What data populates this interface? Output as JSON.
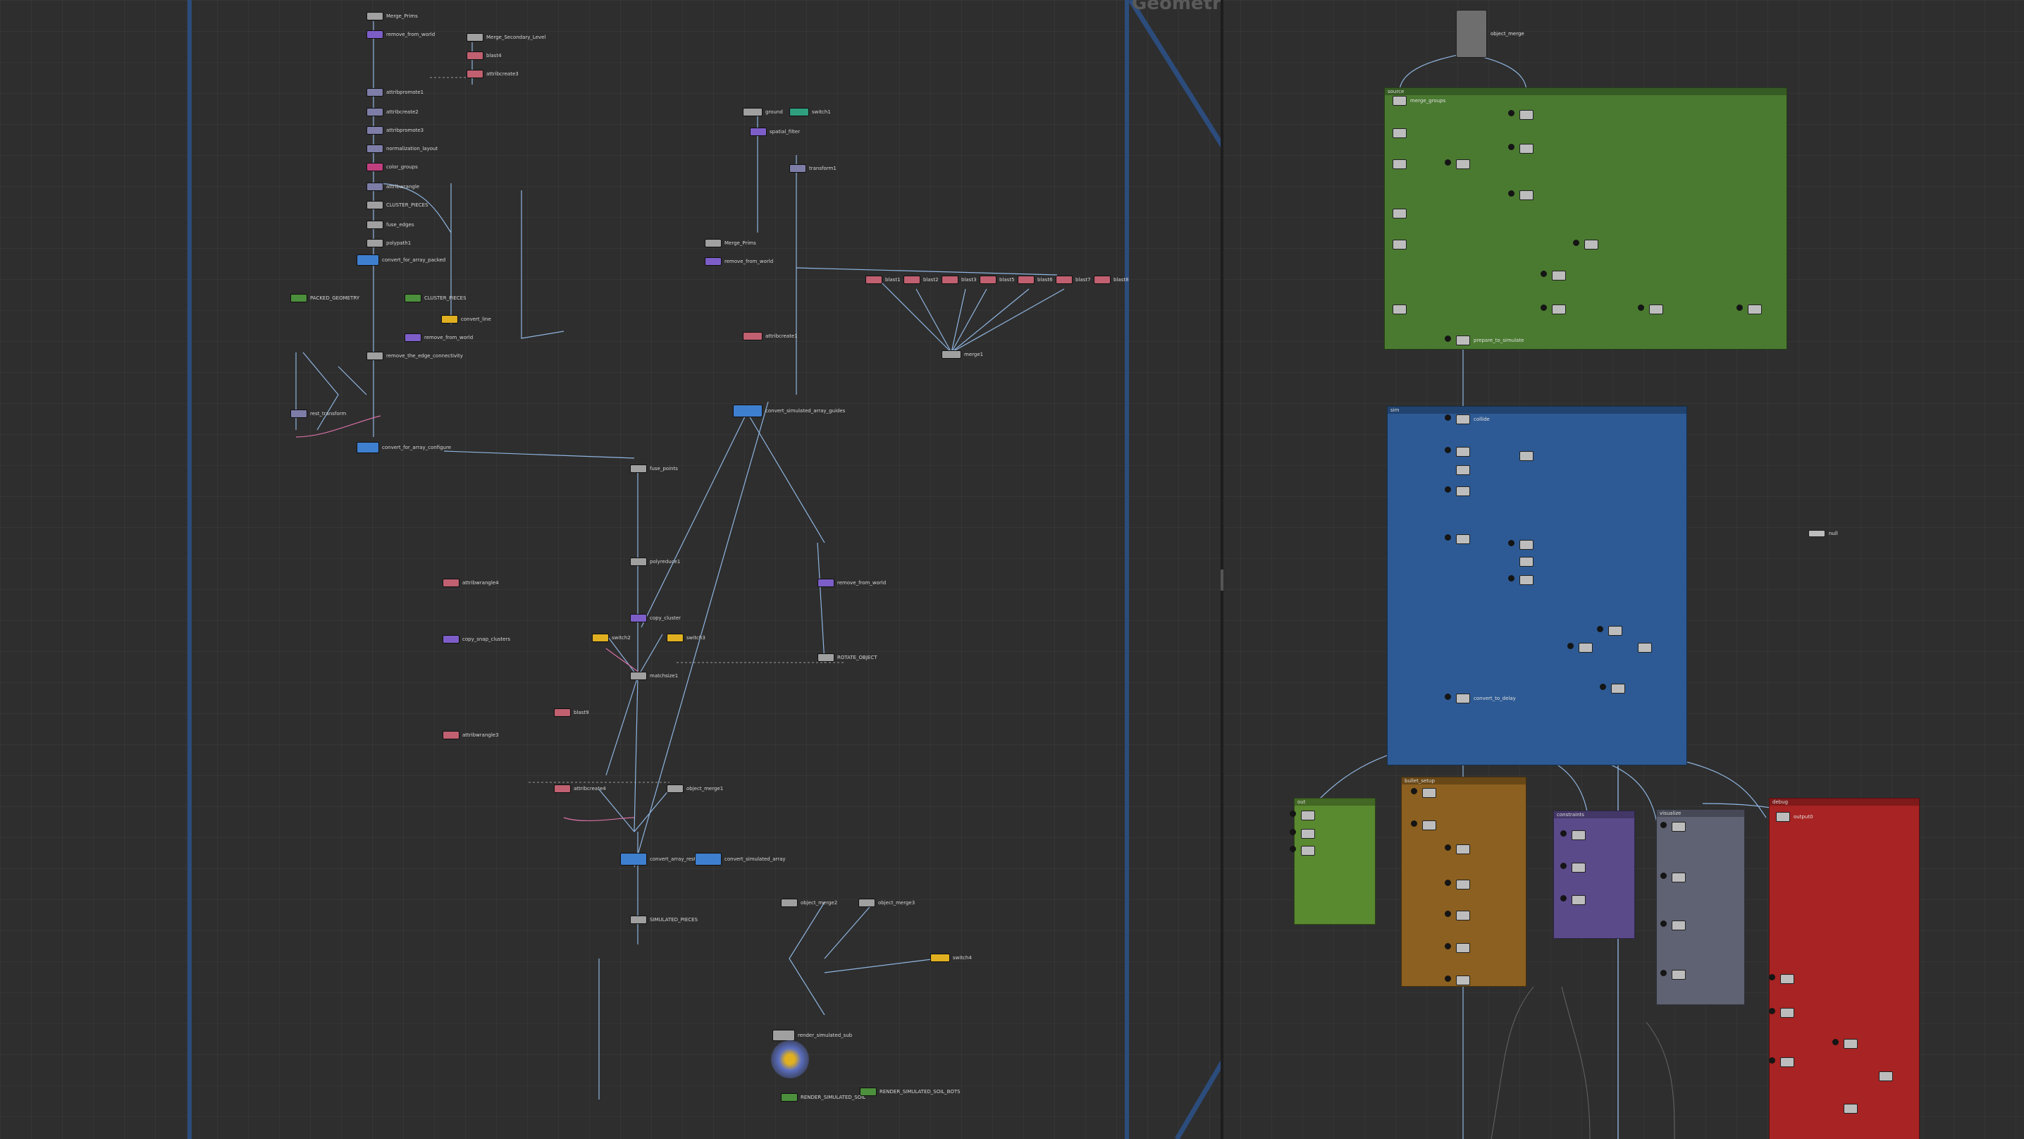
{
  "network": {
    "title": "Geometry"
  },
  "colors": {
    "background": "#2e2e2e",
    "wire": "#8fb5e0",
    "wire_pink": "#d66fa3",
    "netbox_green": "#4a7a30",
    "netbox_blue": "#2d5a94",
    "netbox_orange": "#8c6020",
    "netbox_purple": "#5a4a8a",
    "netbox_slate": "#5e6272",
    "netbox_red": "#a82323",
    "netbox_lime": "#5a8a30"
  },
  "left_nodes": [
    {
      "label": "Merge_Prims",
      "color": "#a0a0a0"
    },
    {
      "label": "remove_from_world",
      "color": "#7d5ec9"
    },
    {
      "label": "Merge_Secondary_Level",
      "color": "#a0a0a0"
    },
    {
      "label": "blast4",
      "color": "#c06070"
    },
    {
      "label": "attribcreate3",
      "color": "#c06070"
    },
    {
      "label": "attribpromote1",
      "color": "#7d7da8"
    },
    {
      "label": "attribcreate2",
      "color": "#7d7da8"
    },
    {
      "label": "attribpromote3",
      "color": "#7d7da8"
    },
    {
      "label": "normalization_layout",
      "color": "#7d7da8"
    },
    {
      "label": "color_groups",
      "color": "#c0407f"
    },
    {
      "label": "attribwrangle",
      "color": "#7d7da8"
    },
    {
      "label": "CLUSTER_PIECES",
      "color": "#a0a0a0"
    },
    {
      "label": "fuse_edges",
      "color": "#a0a0a0"
    },
    {
      "label": "polypath1",
      "color": "#a0a0a0"
    },
    {
      "label": "convert_for_array_packed",
      "color": "#3f7fd0"
    },
    {
      "label": "PACKED_GEOMETRY",
      "color": "#4c8f3c"
    },
    {
      "label": "CLUSTER_PIECES",
      "color": "#4c8f3c"
    },
    {
      "label": "convert_line",
      "color": "#e0b020"
    },
    {
      "label": "remove_from_world",
      "color": "#7d5ec9"
    },
    {
      "label": "remove_the_edge_connectivity",
      "color": "#a0a0a0"
    },
    {
      "label": "rest_transform",
      "color": "#7d7da8"
    },
    {
      "label": "convert_for_array_configure",
      "color": "#3f7fd0"
    },
    {
      "label": "attribwrangle4",
      "color": "#c06070"
    },
    {
      "label": "copy_snap_clusters",
      "color": "#7d5ec9"
    },
    {
      "label": "attribwrangle3",
      "color": "#c06070"
    }
  ],
  "middle_nodes": [
    {
      "label": "ground",
      "color": "#a0a0a0"
    },
    {
      "label": "switch1",
      "color": "#2f9f7f"
    },
    {
      "label": "spatial_filter",
      "color": "#7d5ec9"
    },
    {
      "label": "transform1",
      "color": "#7d7da8"
    },
    {
      "label": "Merge_Prims",
      "color": "#a0a0a0"
    },
    {
      "label": "remove_from_world",
      "color": "#7d5ec9"
    },
    {
      "label": "attribcreate1",
      "color": "#c06070"
    },
    {
      "label": "blast1",
      "color": "#c06070"
    },
    {
      "label": "blast2",
      "color": "#c06070"
    },
    {
      "label": "blast3",
      "color": "#c06070"
    },
    {
      "label": "blast5",
      "color": "#c06070"
    },
    {
      "label": "blast6",
      "color": "#c06070"
    },
    {
      "label": "blast7",
      "color": "#c06070"
    },
    {
      "label": "blast8",
      "color": "#c06070"
    },
    {
      "label": "merge1",
      "color": "#a0a0a0"
    },
    {
      "label": "convert_simulated_array_guides",
      "color": "#3f7fd0"
    },
    {
      "label": "fuse_points",
      "color": "#a0a0a0"
    },
    {
      "label": "polyreduce1",
      "color": "#a0a0a0"
    },
    {
      "label": "copy_cluster",
      "color": "#7d5ec9"
    },
    {
      "label": "switch2",
      "color": "#e0b020"
    },
    {
      "label": "switch3",
      "color": "#e0b020"
    },
    {
      "label": "matchsize1",
      "color": "#a0a0a0"
    },
    {
      "label": "remove_from_world",
      "color": "#7d5ec9"
    },
    {
      "label": "ROTATE_OBJECT",
      "color": "#a0a0a0"
    },
    {
      "label": "object_merge1",
      "color": "#a0a0a0"
    },
    {
      "label": "blast9",
      "color": "#c06070"
    },
    {
      "label": "attribcreate4",
      "color": "#c06070"
    },
    {
      "label": "convert_array_rest",
      "color": "#3f7fd0"
    },
    {
      "label": "convert_simulated_array",
      "color": "#3f7fd0"
    },
    {
      "label": "SIMULATED_PIECES",
      "color": "#a0a0a0"
    },
    {
      "label": "object_merge2",
      "color": "#a0a0a0"
    },
    {
      "label": "object_merge3",
      "color": "#a0a0a0"
    },
    {
      "label": "switch4",
      "color": "#e0b020"
    },
    {
      "label": "render_simulated_sub",
      "color": "#a0a0a0"
    },
    {
      "label": "RENDER_SIMULATED_SOIL",
      "color": "#4c8f3c"
    },
    {
      "label": "RENDER_SIMULATED_SOIL_BOTS",
      "color": "#4c8f3c"
    }
  ],
  "right_nodes": [
    {
      "label": "object_merge",
      "color": "#bdbdbd"
    },
    {
      "label": "merge_groups",
      "color": "#bdbdbd"
    },
    {
      "label": "prepare_to_simulate",
      "color": "#bdbdbd"
    },
    {
      "label": "collide",
      "color": "#bdbdbd"
    },
    {
      "label": "convert_to_delay",
      "color": "#bdbdbd"
    },
    {
      "label": "null",
      "color": "#bdbdbd"
    },
    {
      "label": "output0",
      "color": "#bdbdbd"
    }
  ],
  "netboxes": [
    {
      "title": "source",
      "color": "#4a7a30"
    },
    {
      "title": "sim",
      "color": "#2d5a94"
    },
    {
      "title": "out",
      "color": "#5a8a30"
    },
    {
      "title": "bullet_setup",
      "color": "#8c6020"
    },
    {
      "title": "constraints",
      "color": "#5a4a8a"
    },
    {
      "title": "visualize",
      "color": "#5e6272"
    },
    {
      "title": "debug",
      "color": "#a82323"
    }
  ]
}
